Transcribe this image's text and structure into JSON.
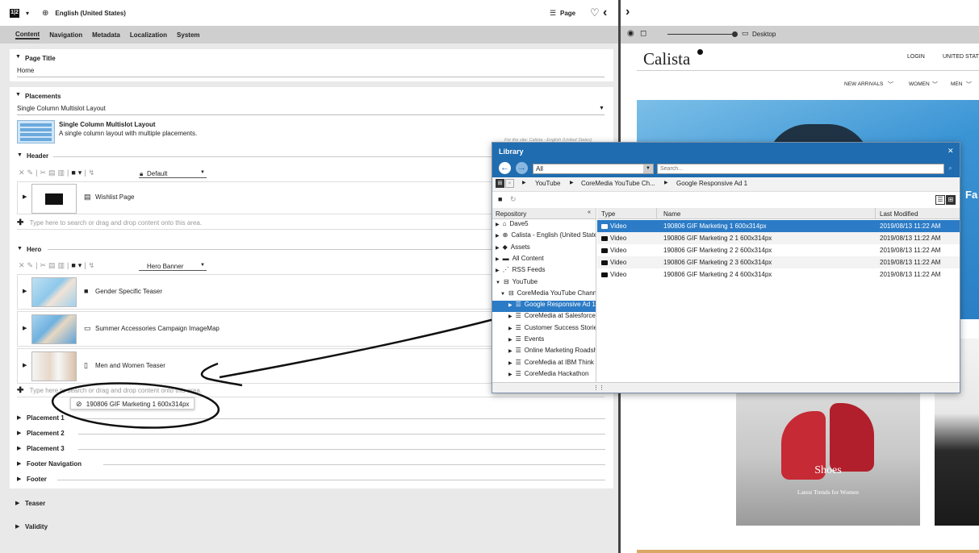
{
  "topbar": {
    "locale_icon": "globe-icon",
    "locale": "English (United States)",
    "page_label": "Page"
  },
  "tabs": [
    "Content",
    "Navigation",
    "Metadata",
    "Localization",
    "System"
  ],
  "page_title": {
    "label": "Page Title",
    "value": "Home"
  },
  "placements": {
    "label": "Placements",
    "layout_select": "Single Column Multislot Layout",
    "layout_name": "Single Column Multislot Layout",
    "layout_desc": "A single column layout with multiple placements.",
    "site_note": "For the site: Calista - English (United States)"
  },
  "header": {
    "label": "Header",
    "view_select": "Default",
    "items": [
      {
        "label": "Wishlist Page"
      }
    ],
    "drop_hint": "Type here to search or drag and drop content onto this area."
  },
  "hero": {
    "label": "Hero",
    "view_select": "Hero Banner",
    "items": [
      {
        "label": "Gender Specific Teaser"
      },
      {
        "label": "Summer Accessories Campaign ImageMap"
      },
      {
        "label": "Men and Women Teaser"
      }
    ],
    "drop_hint": "Type here to search or drag and drop content onto this area.",
    "drag_item": "190806 GIF Marketing 1 600x314px"
  },
  "other_placements": [
    "Placement 1",
    "Placement 2",
    "Placement 3",
    "Footer Navigation",
    "Footer"
  ],
  "bottom_sections": [
    "Teaser",
    "Validity"
  ],
  "preview": {
    "device": "Desktop",
    "brand": "Calista",
    "login": "LOGIN",
    "country": "UNITED STAT",
    "nav": [
      "NEW ARRIVALS",
      "WOMEN",
      "MEN"
    ],
    "side_text": "Fa",
    "shoes_title": "Shoes",
    "shoes_sub": "Latest Trends for Women"
  },
  "library": {
    "title": "Library",
    "filter": "All",
    "search_placeholder": "Search...",
    "breadcrumb": [
      "YouTube",
      "CoreMedia YouTube Ch...",
      "Google Responsive Ad 1"
    ],
    "repo_header": "Repository",
    "repo_items": [
      "Dave5",
      "Calista - English (United States)",
      "Assets",
      "All Content",
      "RSS Feeds",
      "YouTube",
      "CoreMedia YouTube Channel",
      "Google Responsive Ad 1",
      "CoreMedia at Salesforce",
      "Customer Success Stories",
      "Events",
      "Online Marketing Roadshow",
      "CoreMedia at IBM Think",
      "CoreMedia Hackathon"
    ],
    "columns": [
      "Type",
      "Name",
      "Last Modified"
    ],
    "rows": [
      {
        "type": "Video",
        "name": "190806 GIF Marketing 1 600x314px",
        "modified": "2019/08/13 11:22 AM"
      },
      {
        "type": "Video",
        "name": "190806 GIF Marketing 2 1 600x314px",
        "modified": "2019/08/13 11:22 AM"
      },
      {
        "type": "Video",
        "name": "190806 GIF Marketing 2 2 600x314px",
        "modified": "2019/08/13 11:22 AM"
      },
      {
        "type": "Video",
        "name": "190806 GIF Marketing 2 3 600x314px",
        "modified": "2019/08/13 11:22 AM"
      },
      {
        "type": "Video",
        "name": "190806 GIF Marketing 2 4 600x314px",
        "modified": "2019/08/13 11:22 AM"
      }
    ]
  }
}
